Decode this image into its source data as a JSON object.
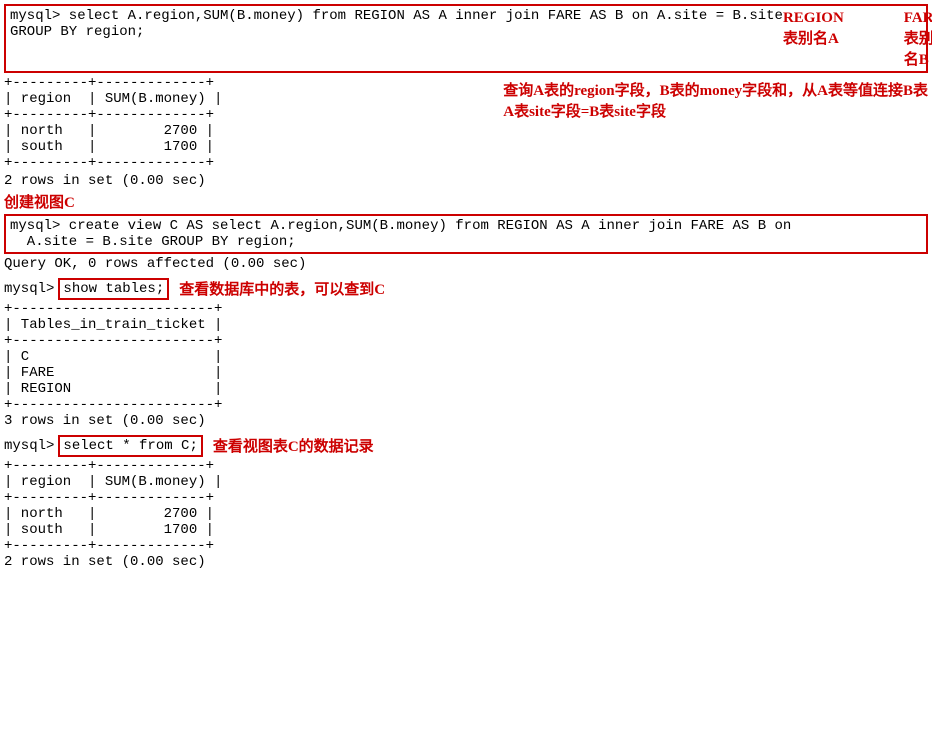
{
  "block1": {
    "query_line1": "mysql> select A.region,SUM(B.money) from REGION AS A inner join FARE AS B on A.site = B.site",
    "query_line2": "GROUP BY region;",
    "label_region": "REGION表别名A",
    "label_fare": "FARE表别名B",
    "annotation_line1": "查询A表的region字段，B表的money字段和，从A表等值连接B表",
    "annotation_line2": "A表site字段=B表site字段",
    "sep1": "+---------+-------------+",
    "header": "| region  | SUM(B.money) |",
    "sep2": "+---------+-------------+",
    "row1": "| north   |        2700 |",
    "row2": "| south   |        1700 |",
    "sep3": "+---------+-------------+",
    "result": "2 rows in set (0.00 sec)"
  },
  "label_create": "创建视图C",
  "block2": {
    "query_line1": "mysql> create view C AS select A.region,SUM(B.money) from REGION AS A inner join FARE AS B on",
    "query_line2": "  A.site = B.site GROUP BY region;",
    "ok_line": "Query OK, 0 rows affected (0.00 sec)"
  },
  "block3": {
    "prompt": "mysql>",
    "command": "show tables;",
    "annotation": "查看数据库中的表，可以查到C",
    "sep1": "+------------------------+",
    "header": "| Tables_in_train_ticket |",
    "sep2": "+------------------------+",
    "row1": "| C                      |",
    "row2": "| FARE                   |",
    "row3": "| REGION                 |",
    "sep3": "+------------------------+",
    "result": "3 rows in set (0.00 sec)"
  },
  "block4": {
    "prompt": "mysql>",
    "command": "select * from C;",
    "annotation": "查看视图表C的数据记录",
    "sep1": "+---------+-------------+",
    "header": "| region  | SUM(B.money) |",
    "sep2": "+---------+-------------+",
    "row1": "| north   |        2700 |",
    "row2": "| south   |        1700 |",
    "sep3": "+---------+-------------+",
    "result": "2 rows in set (0.00 sec)"
  }
}
